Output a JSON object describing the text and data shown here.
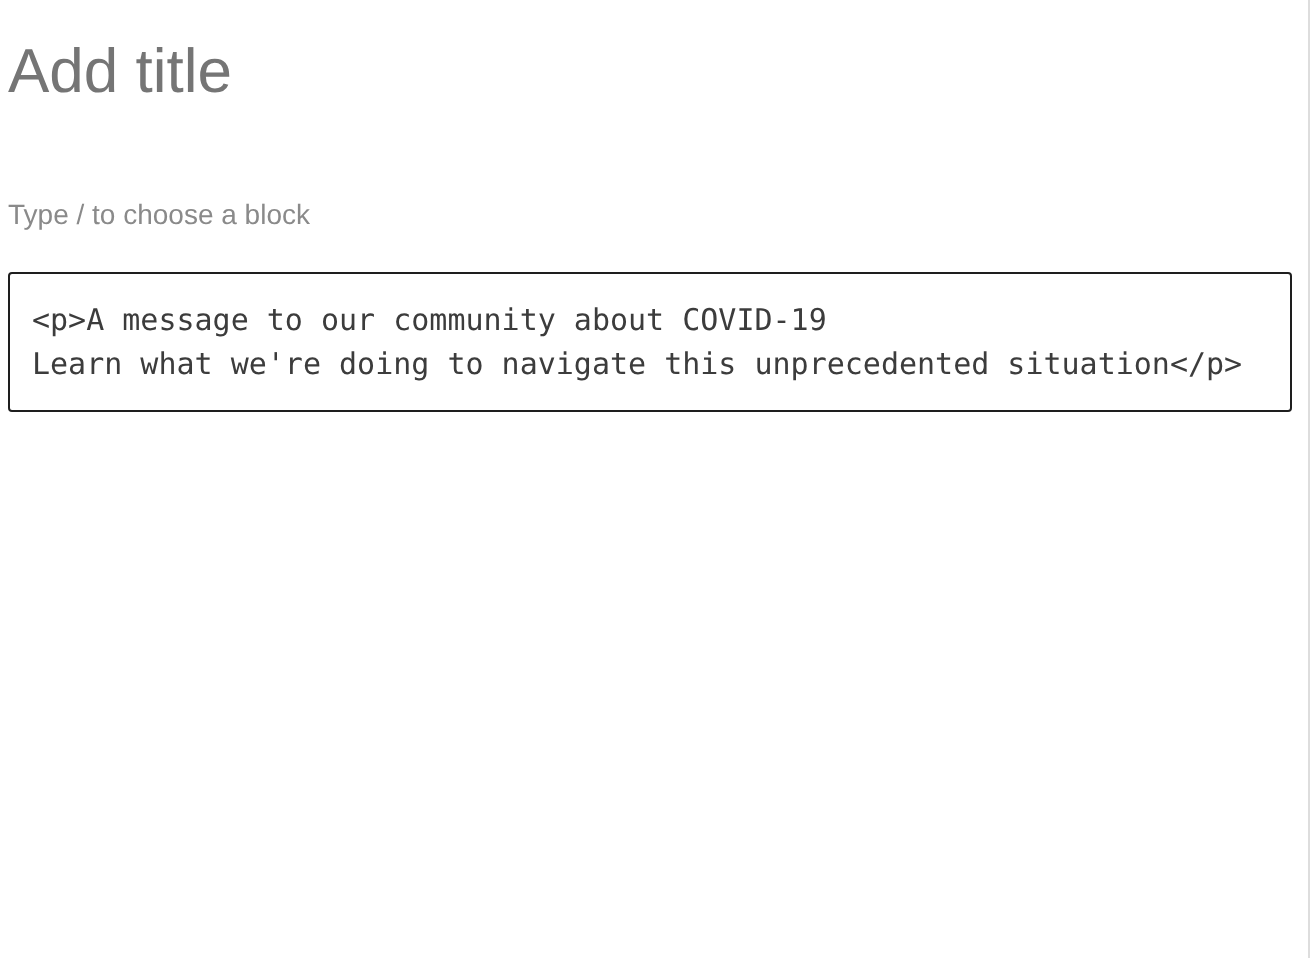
{
  "title_field": {
    "placeholder": "Add title"
  },
  "block_field": {
    "placeholder": "Type / to choose a block"
  },
  "html_block": {
    "lines": [
      "<p>A message to our community about COVID-19",
      "Learn what we're doing to navigate this unprecedented situation</p>"
    ]
  }
}
